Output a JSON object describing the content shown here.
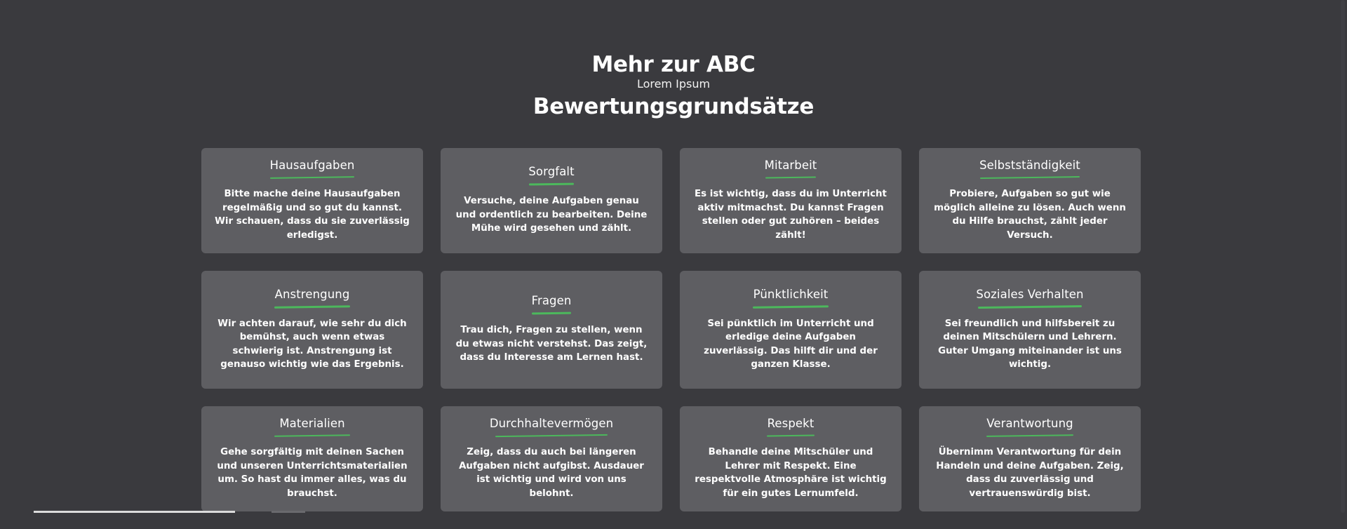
{
  "header": {
    "title": "Mehr zur ABC",
    "subtitle": "Lorem Ipsum",
    "heading": "Bewertungsgrundsätze"
  },
  "colors": {
    "background": "#3a3a3e",
    "card": "#5e5e62",
    "accent": "#4cb85c"
  },
  "cards": [
    {
      "title": "Hausaufgaben",
      "text": "Bitte mache deine Hausaufgaben regelmäßig und so gut du kannst. Wir schauen, dass du sie zuverlässig erledigst."
    },
    {
      "title": "Sorgfalt",
      "text": "Versuche, deine Aufgaben genau und ordentlich zu bearbeiten. Deine Mühe wird gesehen und zählt."
    },
    {
      "title": "Mitarbeit",
      "text": "Es ist wichtig, dass du im Unterricht aktiv mitmachst. Du kannst Fragen stellen oder gut zuhören – beides zählt!"
    },
    {
      "title": "Selbstständigkeit",
      "text": "Probiere, Aufgaben so gut wie möglich alleine zu lösen. Auch wenn du Hilfe brauchst, zählt jeder Versuch."
    },
    {
      "title": "Anstrengung",
      "text": "Wir achten darauf, wie sehr du dich bemühst, auch wenn etwas schwierig ist. Anstrengung ist genauso wichtig wie das Ergebnis."
    },
    {
      "title": "Fragen",
      "text": "Trau dich, Fragen zu stellen, wenn du etwas nicht verstehst. Das zeigt, dass du Interesse am Lernen hast."
    },
    {
      "title": "Pünktlichkeit",
      "text": "Sei pünktlich im Unterricht und erledige deine Aufgaben zuverlässig. Das hilft dir und der ganzen Klasse."
    },
    {
      "title": "Soziales Verhalten",
      "text": "Sei freundlich und hilfsbereit zu deinen Mitschülern und Lehrern. Guter Umgang miteinander ist uns wichtig."
    },
    {
      "title": "Materialien",
      "text": "Gehe sorgfältig mit deinen Sachen und unseren Unterrichtsmaterialien um. So hast du immer alles, was du brauchst."
    },
    {
      "title": "Durchhaltevermögen",
      "text": "Zeig, dass du auch bei längeren Aufgaben nicht aufgibst. Ausdauer ist wichtig und wird von uns belohnt."
    },
    {
      "title": "Respekt",
      "text": "Behandle deine Mitschüler und Lehrer mit Respekt. Eine respektvolle Atmosphäre ist wichtig für ein gutes Lernumfeld."
    },
    {
      "title": "Verantwortung",
      "text": "Übernimm Verantwortung für dein Handeln und deine Aufgaben. Zeig, dass du zuverlässig und vertrauenswürdig bist."
    }
  ]
}
